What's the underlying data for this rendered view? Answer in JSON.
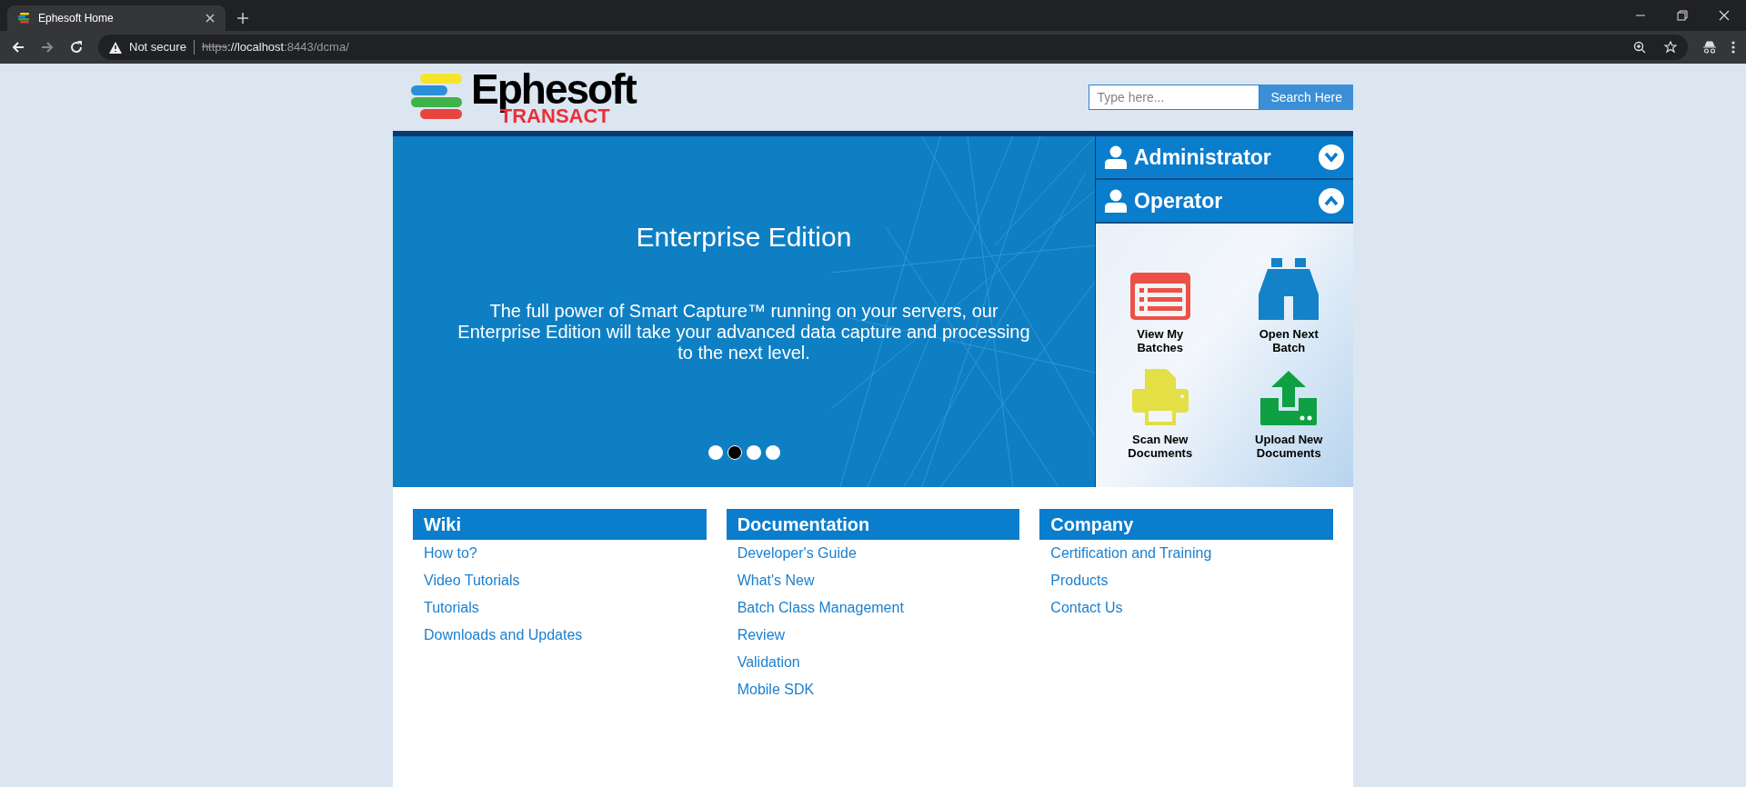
{
  "browser": {
    "tab_title": "Ephesoft Home",
    "security": "Not secure",
    "url_scheme": "https",
    "url_host": "://localhost",
    "url_rest": ":8443/dcma/"
  },
  "header": {
    "logo_name": "Ephesoft",
    "logo_sub": "TRANSACT",
    "search": {
      "placeholder": "Type here...",
      "button": "Search Here"
    }
  },
  "banner": {
    "title": "Enterprise Edition",
    "text": "The full power of Smart Capture™ running on your servers, our Enterprise Edition will take your advanced data capture and processing to the next level.",
    "dots": [
      {
        "selected": false
      },
      {
        "selected": true
      },
      {
        "selected": false
      },
      {
        "selected": false
      }
    ]
  },
  "roles": [
    {
      "label": "Administrator",
      "expanded": false
    },
    {
      "label": "Operator",
      "expanded": true
    }
  ],
  "actions": [
    {
      "kind": "list",
      "label": "View My Batches"
    },
    {
      "kind": "binoculars",
      "label": "Open Next Batch"
    },
    {
      "kind": "printer",
      "label": "Scan New Documents"
    },
    {
      "kind": "upload",
      "label": "Upload New Documents"
    }
  ],
  "link_columns": [
    {
      "heading": "Wiki",
      "links": [
        "How to?",
        "Video Tutorials",
        "Tutorials",
        "Downloads and Updates"
      ]
    },
    {
      "heading": "Documentation",
      "links": [
        "Developer's Guide",
        "What's New",
        "Batch Class Management",
        "Review",
        "Validation",
        "Mobile SDK"
      ]
    },
    {
      "heading": "Company",
      "links": [
        "Certification and Training",
        "Products",
        "Contact Us"
      ]
    }
  ]
}
